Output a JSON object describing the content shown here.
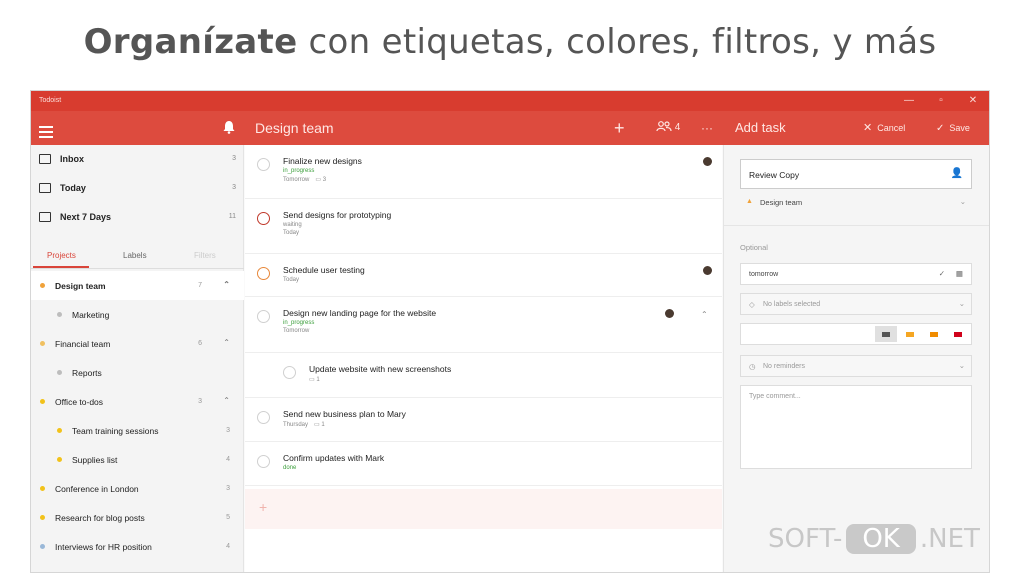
{
  "headline": {
    "bold": "Organízate",
    "rest": " con etiquetas, colores, filtros, y más"
  },
  "window": {
    "app_name": "Todoist",
    "controls": {
      "minimize": "—",
      "maximize": "▫",
      "close": "✕"
    }
  },
  "appbar": {
    "project_title": "Design team",
    "add_symbol": "+",
    "share_count": "4",
    "more_symbol": "···",
    "add_task_title": "Add task",
    "cancel_label": "Cancel",
    "save_label": "Save"
  },
  "sidebar": {
    "filters": [
      {
        "label": "Inbox",
        "count": "3"
      },
      {
        "label": "Today",
        "count": "3"
      },
      {
        "label": "Next 7 Days",
        "count": "11"
      }
    ],
    "tabs": [
      "Projects",
      "Labels",
      "Filters"
    ],
    "projects": [
      {
        "label": "Design team",
        "count": "7",
        "color": "#f0a23a",
        "indent": false,
        "selected": true,
        "expand": "⌃"
      },
      {
        "label": "Marketing",
        "count": "",
        "color": "#bdbdbd",
        "indent": true
      },
      {
        "label": "Financial team",
        "count": "6",
        "color": "#f0c060",
        "indent": false,
        "expand": "⌃"
      },
      {
        "label": "Reports",
        "count": "",
        "color": "#bdbdbd",
        "indent": true
      },
      {
        "label": "Office to-dos",
        "count": "3",
        "color": "#f2c21a",
        "indent": false,
        "expand": "⌃"
      },
      {
        "label": "Team training sessions",
        "count": "3",
        "color": "#f2c21a",
        "indent": true
      },
      {
        "label": "Supplies list",
        "count": "4",
        "color": "#f2c21a",
        "indent": true
      },
      {
        "label": "Conference in London",
        "count": "3",
        "color": "#f2c21a",
        "indent": false
      },
      {
        "label": "Research for blog posts",
        "count": "5",
        "color": "#f2c21a",
        "indent": false
      },
      {
        "label": "Interviews for HR position",
        "count": "4",
        "color": "#9ab8d8",
        "indent": false
      }
    ]
  },
  "tasks": [
    {
      "title": "Finalize new designs",
      "label": "in_progress",
      "meta": "Tomorrow",
      "comments": "3",
      "avatar": true
    },
    {
      "title": "Send designs for prototyping",
      "label": "waiting",
      "meta": "Today",
      "circle": "#c0392b"
    },
    {
      "title": "Schedule user testing",
      "label": "",
      "meta": "Today",
      "circle": "#e8883a",
      "avatar": true
    },
    {
      "title": "Design new landing page for the website",
      "label": "in_progress",
      "meta": "Tomorrow",
      "avatar": true,
      "expand": "⌃"
    },
    {
      "title": "Update website with new screenshots",
      "label": "",
      "meta": "",
      "comments": "1",
      "indent": true
    },
    {
      "title": "Send new business plan to Mary",
      "label": "",
      "meta": "Thursday",
      "comments": "1"
    },
    {
      "title": "Confirm updates with Mark",
      "label": "done",
      "meta": ""
    }
  ],
  "add_row": {
    "symbol": "+"
  },
  "panel": {
    "task_input_value": "Review Copy",
    "project_select": "Design team",
    "optional_label": "Optional",
    "date_value": "tomorrow",
    "labels_placeholder": "No labels selected",
    "reminders_placeholder": "No reminders",
    "comment_placeholder": "Type comment...",
    "priority_colors": [
      "#555555",
      "#f5a623",
      "#f08c00",
      "#d0021b"
    ]
  },
  "watermark": {
    "left": "SOFT-",
    "ok": "OK",
    "right": ".NET"
  }
}
